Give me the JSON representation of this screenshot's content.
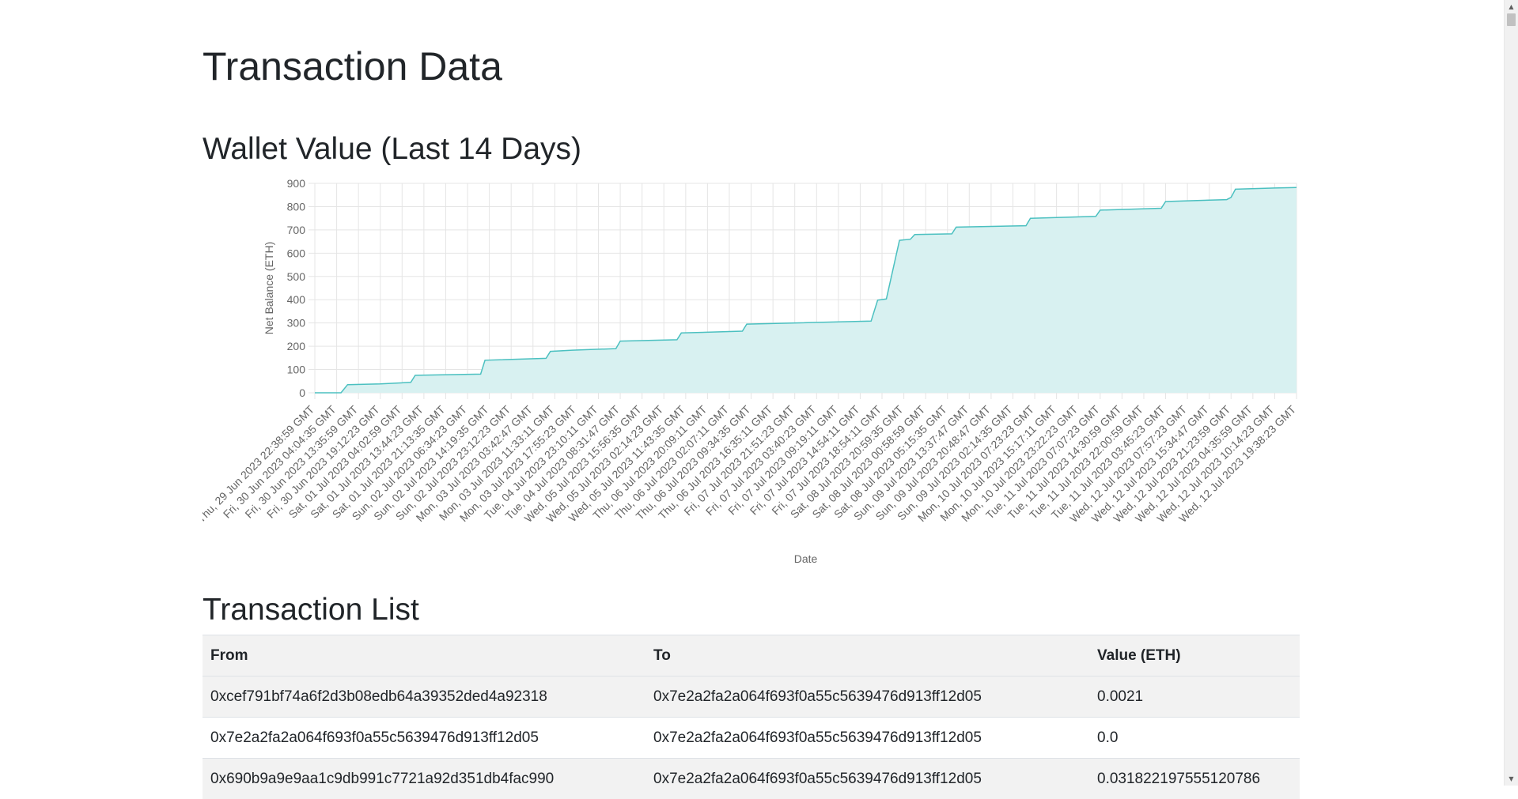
{
  "page": {
    "title": "Transaction Data"
  },
  "chart_section": {
    "title": "Wallet Value (Last 14 Days)"
  },
  "chart_data": {
    "type": "area",
    "title": "",
    "xlabel": "Date",
    "ylabel": "Net Balance (ETH)",
    "ylim": [
      0,
      900
    ],
    "yticks": [
      0,
      100,
      200,
      300,
      400,
      500,
      600,
      700,
      800,
      900
    ],
    "grid": true,
    "legend": "none",
    "colors": {
      "line": "#4bc0c0",
      "fill": "#d8f1f1",
      "grid": "#e5e5e5",
      "axis_text": "#666666"
    },
    "categories": [
      "Thu, 29 Jun 2023 22:38:59 GMT",
      "Fri, 30 Jun 2023 04:04:35 GMT",
      "Fri, 30 Jun 2023 13:35:59 GMT",
      "Fri, 30 Jun 2023 19:12:23 GMT",
      "Sat, 01 Jul 2023 04:02:59 GMT",
      "Sat, 01 Jul 2023 13:44:23 GMT",
      "Sat, 01 Jul 2023 21:13:35 GMT",
      "Sun, 02 Jul 2023 06:34:23 GMT",
      "Sun, 02 Jul 2023 14:19:35 GMT",
      "Sun, 02 Jul 2023 23:12:23 GMT",
      "Mon, 03 Jul 2023 03:42:47 GMT",
      "Mon, 03 Jul 2023 11:33:11 GMT",
      "Mon, 03 Jul 2023 17:55:23 GMT",
      "Tue, 04 Jul 2023 23:10:11 GMT",
      "Tue, 04 Jul 2023 08:31:47 GMT",
      "Wed, 05 Jul 2023 15:56:35 GMT",
      "Wed, 05 Jul 2023 02:14:23 GMT",
      "Wed, 05 Jul 2023 11:43:35 GMT",
      "Thu, 06 Jul 2023 20:09:11 GMT",
      "Thu, 06 Jul 2023 02:07:11 GMT",
      "Thu, 06 Jul 2023 09:34:35 GMT",
      "Thu, 06 Jul 2023 16:35:11 GMT",
      "Fri, 07 Jul 2023 21:51:23 GMT",
      "Fri, 07 Jul 2023 03:40:23 GMT",
      "Fri, 07 Jul 2023 09:19:11 GMT",
      "Fri, 07 Jul 2023 14:54:11 GMT",
      "Fri, 07 Jul 2023 18:54:11 GMT",
      "Sat, 08 Jul 2023 20:59:35 GMT",
      "Sat, 08 Jul 2023 00:58:59 GMT",
      "Sat, 08 Jul 2023 05:15:35 GMT",
      "Sun, 09 Jul 2023 13:37:47 GMT",
      "Sun, 09 Jul 2023 20:48:47 GMT",
      "Sun, 09 Jul 2023 02:14:35 GMT",
      "Mon, 10 Jul 2023 07:23:23 GMT",
      "Mon, 10 Jul 2023 15:17:11 GMT",
      "Mon, 10 Jul 2023 23:22:23 GMT",
      "Tue, 11 Jul 2023 07:07:23 GMT",
      "Tue, 11 Jul 2023 14:30:59 GMT",
      "Tue, 11 Jul 2023 22:00:59 GMT",
      "Tue, 11 Jul 2023 03:45:23 GMT",
      "Wed, 12 Jul 2023 07:57:23 GMT",
      "Wed, 12 Jul 2023 15:34:47 GMT",
      "Wed, 12 Jul 2023 21:23:59 GMT",
      "Wed, 12 Jul 2023 04:35:59 GMT",
      "Wed, 12 Jul 2023 10:14:23 GMT",
      "Wed, 12 Jul 2023 19:38:23 GMT"
    ],
    "series": [
      {
        "values": [
          [
            0,
            0
          ],
          [
            1.2,
            0
          ],
          [
            1.5,
            35
          ],
          [
            3.0,
            38
          ],
          [
            4.4,
            45
          ],
          [
            4.6,
            75
          ],
          [
            7.6,
            80
          ],
          [
            7.8,
            140
          ],
          [
            10.6,
            148
          ],
          [
            10.8,
            178
          ],
          [
            11.8,
            183
          ],
          [
            13.8,
            190
          ],
          [
            14.0,
            222
          ],
          [
            16.6,
            228
          ],
          [
            16.8,
            257
          ],
          [
            19.6,
            265
          ],
          [
            19.8,
            295
          ],
          [
            25.5,
            308
          ],
          [
            25.8,
            398
          ],
          [
            26.2,
            403
          ],
          [
            26.8,
            655
          ],
          [
            27.3,
            660
          ],
          [
            27.5,
            680
          ],
          [
            29.2,
            683
          ],
          [
            29.4,
            712
          ],
          [
            32.6,
            718
          ],
          [
            32.8,
            750
          ],
          [
            35.8,
            758
          ],
          [
            36.0,
            785
          ],
          [
            38.8,
            793
          ],
          [
            39.0,
            822
          ],
          [
            41.8,
            830
          ],
          [
            42.0,
            840
          ],
          [
            42.2,
            875
          ],
          [
            44.0,
            880
          ],
          [
            45.0,
            882
          ]
        ]
      }
    ]
  },
  "list_section": {
    "title": "Transaction List"
  },
  "table": {
    "headers": [
      "From",
      "To",
      "Value (ETH)"
    ],
    "rows": [
      [
        "0xcef791bf74a6f2d3b08edb64a39352ded4a92318",
        "0x7e2a2fa2a064f693f0a55c5639476d913ff12d05",
        "0.0021"
      ],
      [
        "0x7e2a2fa2a064f693f0a55c5639476d913ff12d05",
        "0x7e2a2fa2a064f693f0a55c5639476d913ff12d05",
        "0.0"
      ],
      [
        "0x690b9a9e9aa1c9db991c7721a92d351db4fac990",
        "0x7e2a2fa2a064f693f0a55c5639476d913ff12d05",
        "0.031822197555120786"
      ]
    ]
  },
  "scrollbar": {
    "up_icon": "scroll-up-arrow-icon",
    "down_icon": "scroll-down-arrow-icon"
  }
}
